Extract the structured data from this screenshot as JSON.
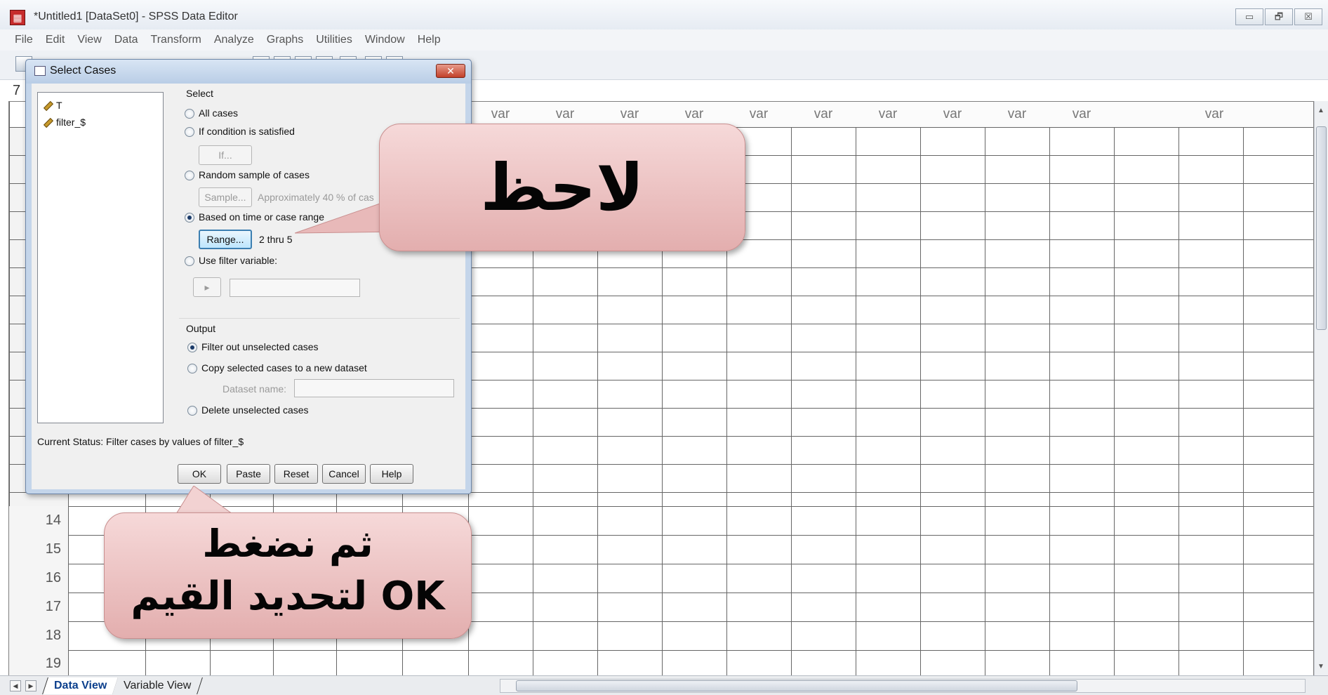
{
  "window": {
    "title": "*Untitled1 [DataSet0] - SPSS Data Editor",
    "controls": {
      "minimize": "▭",
      "restore": "🗗",
      "close": "☒"
    }
  },
  "menu": [
    "File",
    "Edit",
    "View",
    "Data",
    "Transform",
    "Analyze",
    "Graphs",
    "Utilities",
    "Window",
    "Help"
  ],
  "cell_ref": "7",
  "grid": {
    "column_header": "var",
    "row_numbers": [
      "14",
      "15",
      "16",
      "17",
      "18",
      "19"
    ]
  },
  "tabs": {
    "data_view": "Data View",
    "variable_view": "Variable View"
  },
  "dialog": {
    "title": "Select Cases",
    "close_label": "✕",
    "variables": [
      "T",
      "filter_$"
    ],
    "select_heading": "Select",
    "options": {
      "all_cases": "All cases",
      "if_condition": "If condition is satisfied",
      "if_button": "If...",
      "random_sample": "Random sample of cases",
      "sample_button": "Sample...",
      "sample_desc": "Approximately 40 % of cas",
      "time_range": "Based on time or case range",
      "range_button": "Range...",
      "range_value": "2 thru  5",
      "filter_variable": "Use filter variable:",
      "filter_arrow": "▸"
    },
    "output_heading": "Output",
    "output": {
      "filter_out": "Filter out unselected cases",
      "copy_to_dataset": "Copy selected cases to a new dataset",
      "dataset_name_label": "Dataset name:",
      "delete": "Delete unselected cases"
    },
    "status": "Current Status: Filter cases by values of filter_$",
    "buttons": {
      "ok": "OK",
      "paste": "Paste",
      "reset": "Reset",
      "cancel": "Cancel",
      "help": "Help"
    }
  },
  "callouts": {
    "notice": "لاحظ",
    "press_line1": "ثم نضغط",
    "press_line2": "OK لتحديد القيم"
  },
  "colors": {
    "callout": "#e8b7b7",
    "dialog_frame": "#c4d5ea",
    "focus_button": "#3c7fb1"
  }
}
